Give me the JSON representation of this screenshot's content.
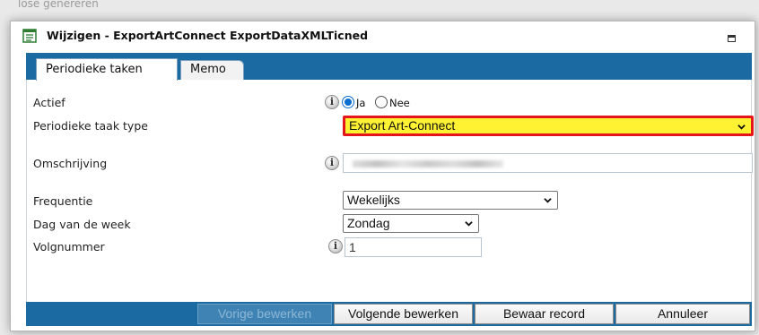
{
  "background": {
    "caption": "lose genereren"
  },
  "dialog": {
    "title": "Wijzigen - ExportArtConnect ExportDataXMLTicned"
  },
  "tabs": [
    {
      "label": "Periodieke taken",
      "active": true
    },
    {
      "label": "Memo",
      "active": false
    }
  ],
  "form": {
    "actief": {
      "label": "Actief",
      "info_icon": "info-icon",
      "options": [
        {
          "label": "Ja",
          "selected": true
        },
        {
          "label": "Nee",
          "selected": false
        }
      ]
    },
    "taak_type": {
      "label": "Periodieke taak type",
      "value": "Export Art-Connect",
      "highlight_bg": "#fff233",
      "highlight_border": "#e4161b"
    },
    "omschrijving": {
      "label": "Omschrijving",
      "info_icon": "info-icon",
      "value_blurred": true
    },
    "frequentie": {
      "label": "Frequentie",
      "value": "Wekelijks"
    },
    "dag": {
      "label": "Dag van de week",
      "value": "Zondag"
    },
    "volgnummer": {
      "label": "Volgnummer",
      "info_icon": "info-icon",
      "value": "1"
    }
  },
  "footer": {
    "buttons": [
      {
        "label": "Vorige bewerken",
        "enabled": false
      },
      {
        "label": "Volgende bewerken",
        "enabled": true
      },
      {
        "label": "Bewaar record",
        "enabled": true
      },
      {
        "label": "Annuleer",
        "enabled": true
      }
    ]
  },
  "colors": {
    "accent": "#1b6ba2",
    "radio_selected": "#0a6ed1"
  }
}
